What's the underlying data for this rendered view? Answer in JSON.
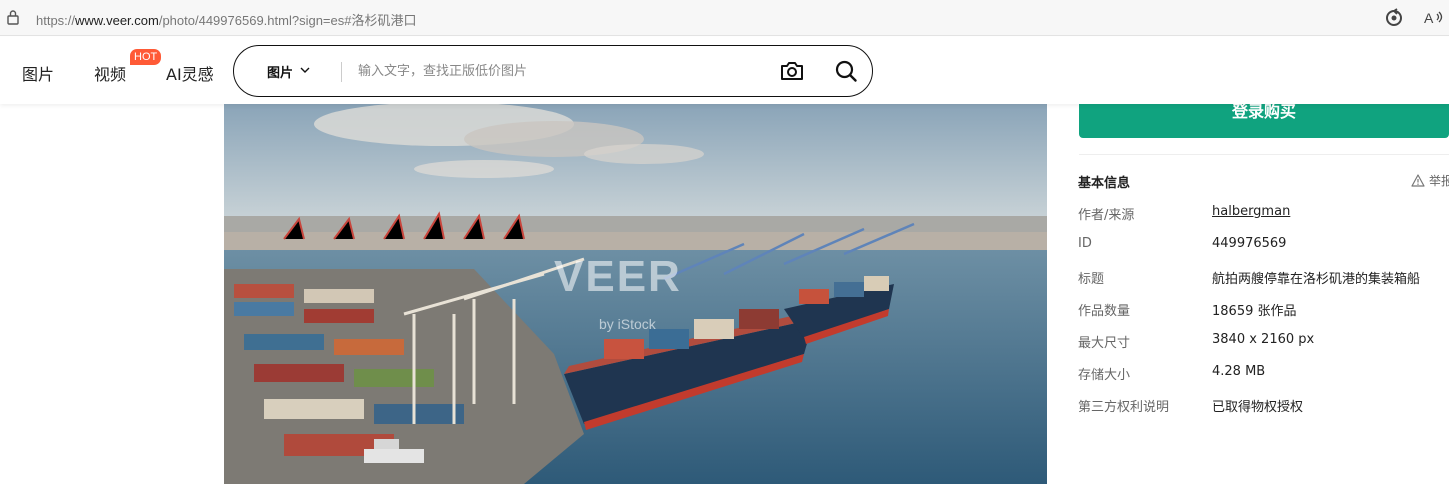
{
  "browser": {
    "url_prefix": "https://",
    "url_host": "www.veer.com",
    "url_rest": "/photo/449976569.html?sign=es#洛杉矶港口",
    "icons": [
      "lock-icon",
      "reload-icon",
      "read-aloud-icon"
    ]
  },
  "header": {
    "nav": [
      "图片",
      "视频",
      "AI灵感"
    ],
    "hot_badge": "HOT",
    "search": {
      "type_label": "图片",
      "placeholder": "输入文字，查找正版低价图片"
    }
  },
  "photo": {
    "watermark": "VEER",
    "watermark_sub": "by iStock"
  },
  "sidebar": {
    "buy_button": "登录购买",
    "section_title": "基本信息",
    "report_label": "举报",
    "info": [
      {
        "label": "作者/来源",
        "value": "halbergman"
      },
      {
        "label": "ID",
        "value": "449976569"
      },
      {
        "label": "标题",
        "value": "航拍两艘停靠在洛杉矶港的集装箱船"
      },
      {
        "label": "作品数量",
        "value": "18659 张作品"
      },
      {
        "label": "最大尺寸",
        "value": "3840 x 2160 px"
      },
      {
        "label": "存储大小",
        "value": "4.28 MB"
      },
      {
        "label": "第三方权利说明",
        "value": "已取得物权授权"
      }
    ]
  },
  "colors": {
    "accent": "#10a37f",
    "hot": "#ff5a36"
  }
}
